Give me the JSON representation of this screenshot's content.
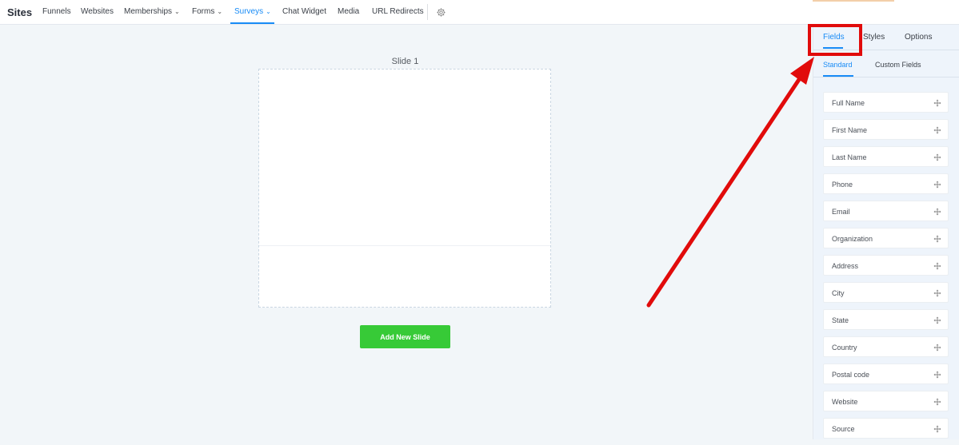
{
  "nav": {
    "brand": "Sites",
    "items": [
      {
        "label": "Funnels",
        "dropdown": false,
        "active": false
      },
      {
        "label": "Websites",
        "dropdown": false,
        "active": false
      },
      {
        "label": "Memberships",
        "dropdown": true,
        "active": false
      },
      {
        "label": "Forms",
        "dropdown": true,
        "active": false
      },
      {
        "label": "Surveys",
        "dropdown": true,
        "active": true
      },
      {
        "label": "Chat Widget",
        "dropdown": false,
        "active": false
      },
      {
        "label": "Media",
        "dropdown": false,
        "active": false
      },
      {
        "label": "URL Redirects",
        "dropdown": false,
        "active": false
      }
    ],
    "settings_icon": "gear-icon"
  },
  "canvas": {
    "slide_title": "Slide 1",
    "add_slide_label": "Add New Slide"
  },
  "panel": {
    "tabs": [
      "Fields",
      "Styles",
      "Options"
    ],
    "active_tab": "Fields",
    "subtabs": [
      "Standard",
      "Custom Fields"
    ],
    "active_subtab": "Standard",
    "fields": [
      "Full Name",
      "First Name",
      "Last Name",
      "Phone",
      "Email",
      "Organization",
      "Address",
      "City",
      "State",
      "Country",
      "Postal code",
      "Website",
      "Source"
    ]
  },
  "colors": {
    "accent": "#188bf6",
    "button_green": "#37ca37",
    "annotation_red": "#e10b0b"
  }
}
